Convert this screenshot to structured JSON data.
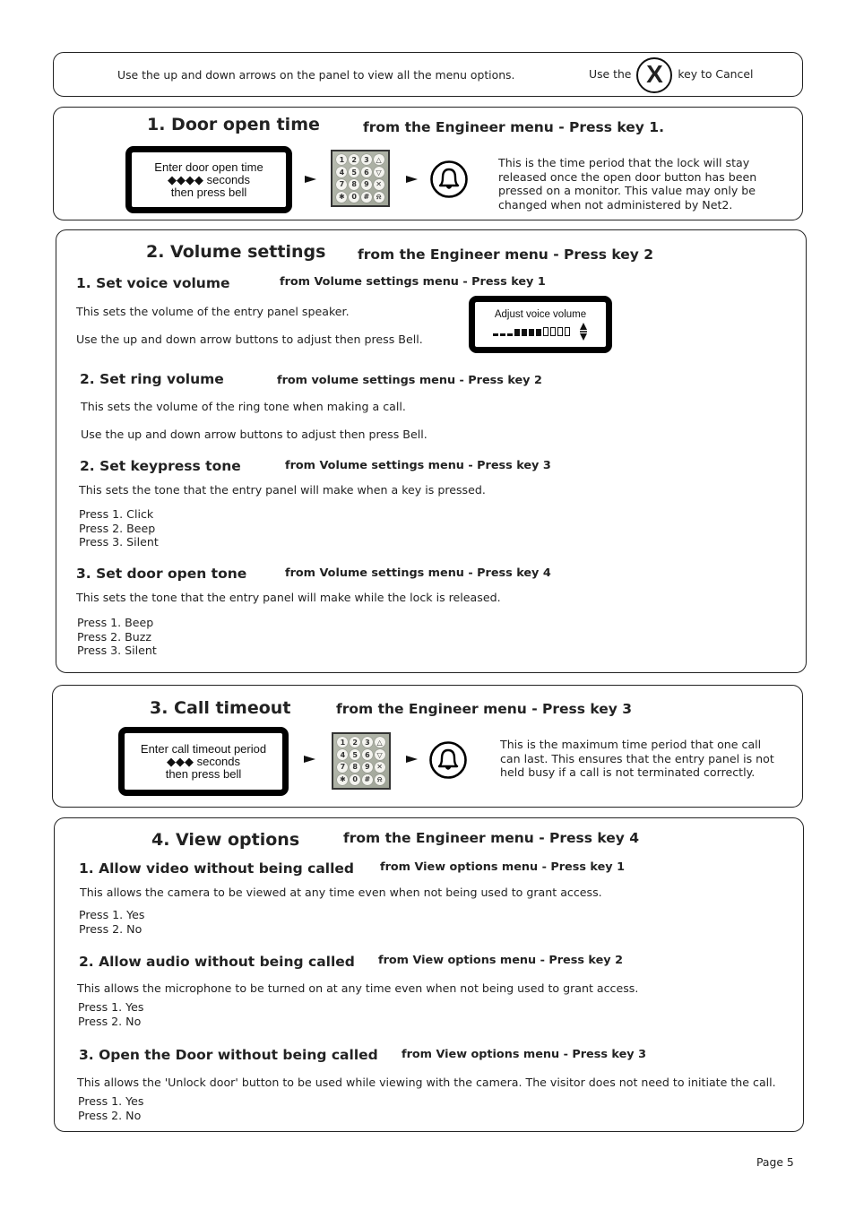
{
  "top_notice": {
    "arrows_text": "Use the up and down arrows on the panel to view all the menu options.",
    "cancel_prefix": "Use the",
    "cancel_key": "X",
    "cancel_suffix": "key to Cancel"
  },
  "section1": {
    "title": "1. Door open time",
    "from": "from the Engineer menu - Press key 1.",
    "lcd_lines": [
      "Enter door open time",
      "◆◆◆◆ seconds",
      "then press bell"
    ],
    "description": [
      "This is the time period that the lock will stay",
      "released once the open door button has been",
      "pressed on a monitor. This value may only be",
      "changed when not administered by Net2."
    ]
  },
  "keypad": {
    "keys": [
      "1",
      "2",
      "3",
      "△",
      "4",
      "5",
      "6",
      "▽",
      "7",
      "8",
      "9",
      "✕",
      "✱",
      "0",
      "#",
      "⍾"
    ]
  },
  "section2": {
    "title": "2. Volume settings",
    "from": "from the Engineer menu - Press key 2",
    "sub1": {
      "title": "1. Set voice volume",
      "from": "from Volume settings menu - Press key 1",
      "line1": "This sets the volume of the entry panel speaker.",
      "line2": "Use the up and down arrow buttons to adjust then press Bell.",
      "lcd_label": "Adjust voice volume",
      "volume_level": 7,
      "volume_max": 11
    },
    "sub2": {
      "title": "2. Set ring volume",
      "from": "from volume settings menu - Press key 2",
      "line1": "This sets the volume of the ring tone when making a call.",
      "line2": "Use the up and down arrow buttons to adjust then press Bell."
    },
    "sub3": {
      "title": "2. Set keypress tone",
      "from": "from Volume settings menu - Press key 3",
      "line1": "This sets the tone that the entry panel will make when a key is pressed.",
      "options": [
        "Press 1.  Click",
        "Press 2.  Beep",
        "Press 3.  Silent"
      ]
    },
    "sub4": {
      "title": "3. Set door open tone",
      "from": "from Volume settings menu - Press key 4",
      "line1": "This sets the tone that the entry panel will make while the lock is released.",
      "options": [
        "Press 1.  Beep",
        "Press 2.  Buzz",
        "Press 3.  Silent"
      ]
    }
  },
  "section3": {
    "title": "3. Call timeout",
    "from": "from the Engineer menu - Press key 3",
    "lcd_lines": [
      "Enter call timeout period",
      "◆◆◆ seconds",
      "then press bell"
    ],
    "description": [
      "This is the maximum time period that one call",
      "can last. This ensures that the entry panel is not",
      "held busy if a call is not terminated correctly."
    ]
  },
  "section4": {
    "title": "4. View options",
    "from": "from the Engineer menu - Press key 4",
    "sub1": {
      "title": "1. Allow video without being called",
      "from": "from View options menu - Press key 1",
      "line1": "This allows the camera to be viewed at any time even when not being used to grant access.",
      "options": [
        "Press 1.  Yes",
        "Press 2.  No"
      ]
    },
    "sub2": {
      "title": "2. Allow audio without being called",
      "from": "from View options menu - Press key 2",
      "line1": "This allows the microphone to be turned on at any time even when not being used to grant access.",
      "options": [
        "Press 1.  Yes",
        "Press 2.  No"
      ]
    },
    "sub3": {
      "title": "3. Open the Door without being called",
      "from": "from View options menu - Press key 3",
      "line1": "This allows the 'Unlock door' button to be used while viewing with the camera. The visitor does not need to initiate the call.",
      "options": [
        "Press 1.  Yes",
        "Press 2.  No"
      ]
    }
  },
  "footer": {
    "page": "Page 5"
  }
}
